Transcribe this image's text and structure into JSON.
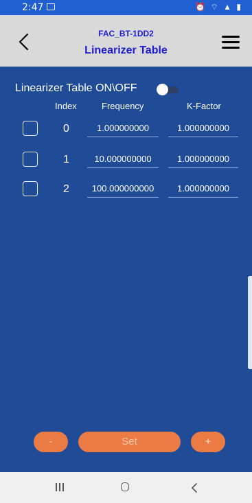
{
  "status_bar": {
    "time": "2:47",
    "image_icon": "image-icon",
    "indicators": "⏰ ⌔ ▲ ▮"
  },
  "app_bar": {
    "subtitle": "FAC_BT-1DD2",
    "title": "Linearizer Table"
  },
  "toggle": {
    "label": "Linearizer Table ON\\OFF",
    "state": "off"
  },
  "table": {
    "headers": {
      "index": "Index",
      "frequency": "Frequency",
      "kfactor": "K-Factor"
    },
    "rows": [
      {
        "index": "0",
        "frequency": "1.000000000",
        "kfactor": "1.000000000"
      },
      {
        "index": "1",
        "frequency": "10.000000000",
        "kfactor": "1.000000000"
      },
      {
        "index": "2",
        "frequency": "100.000000000",
        "kfactor": "1.000000000"
      }
    ]
  },
  "buttons": {
    "minus": "-",
    "set": "Set",
    "plus": "+"
  },
  "colors": {
    "background": "#1f4b97",
    "accent": "#ea7b45",
    "title": "#1d1dd6",
    "appbar": "#d9d9d9"
  }
}
